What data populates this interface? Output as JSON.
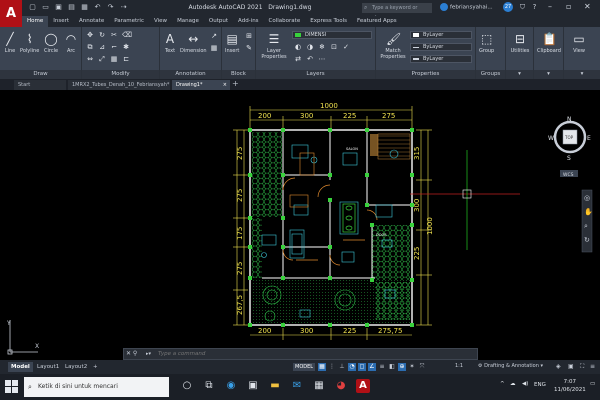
{
  "title": {
    "app": "Autodesk AutoCAD 2021",
    "file": "Drawing1.dwg",
    "search_placeholder": "Type a keyword or phrase",
    "user": "febriansyahai...",
    "notifications": "27"
  },
  "app_logo": "A",
  "ribbon_tabs": [
    "Home",
    "Insert",
    "Annotate",
    "Parametric",
    "View",
    "Manage",
    "Output",
    "Add-ins",
    "Collaborate",
    "Express Tools",
    "Featured Apps"
  ],
  "ribbon": {
    "draw": {
      "title": "Draw",
      "tools": [
        "Line",
        "Polyline",
        "Circle",
        "Arc"
      ]
    },
    "modify": {
      "title": "Modify"
    },
    "annotation": {
      "title": "Annotation",
      "tools": [
        "Text",
        "Dimension"
      ]
    },
    "block": {
      "title": "Block",
      "tools": [
        "Insert"
      ]
    },
    "layers": {
      "title": "Layers",
      "tools": [
        "Layer Properties"
      ],
      "current_layer": "DIMENSI"
    },
    "properties": {
      "title": "Properties",
      "tools": [
        "Match Properties"
      ],
      "color": "ByLayer",
      "linetype": "ByLayer",
      "lineweight": "ByLayer"
    },
    "groups": {
      "title": "Groups",
      "tools": [
        "Group"
      ]
    },
    "utilities": {
      "title": "Utilities"
    },
    "clipboard": {
      "title": "Clipboard"
    },
    "view": {
      "title": "View"
    }
  },
  "file_tabs": {
    "start": "Start",
    "file1": "1MRX2_Tubes_Denah_10_Febriansyah*",
    "file2": "Drawing1*"
  },
  "drawing": {
    "dims_top": [
      "1000",
      "200",
      "300",
      "225",
      "275"
    ],
    "dims_bottom": [
      "200",
      "300",
      "225",
      "275,75"
    ],
    "dims_left": [
      "275",
      "275",
      "175",
      "275",
      "267,5"
    ],
    "dims_right": [
      "315",
      "300",
      "1000",
      "225"
    ],
    "room_labels": [
      "SALON",
      "DOOR"
    ]
  },
  "viewcube": {
    "top": "TOP",
    "n": "N",
    "s": "S",
    "e": "E",
    "w": "W",
    "wcs": "WCS"
  },
  "command": {
    "placeholder": "Type a command"
  },
  "layout_tabs": [
    "Model",
    "Layout1",
    "Layout2"
  ],
  "status": {
    "model": "MODEL",
    "scale": "1:1",
    "workspace": "Drafting & Annotation"
  },
  "taskbar": {
    "search": "Ketik di sini untuk mencari",
    "language": "ENG",
    "time": "7:07",
    "date": "11/06/2021"
  },
  "colors": {
    "wall": "#ffffff",
    "dimension": "#f2e34f",
    "hatch": "#2fbf4a",
    "furniture": "#3ec6d9",
    "column": "#38d13c",
    "accent": "#2b7fd4",
    "logo": "#b01016"
  }
}
